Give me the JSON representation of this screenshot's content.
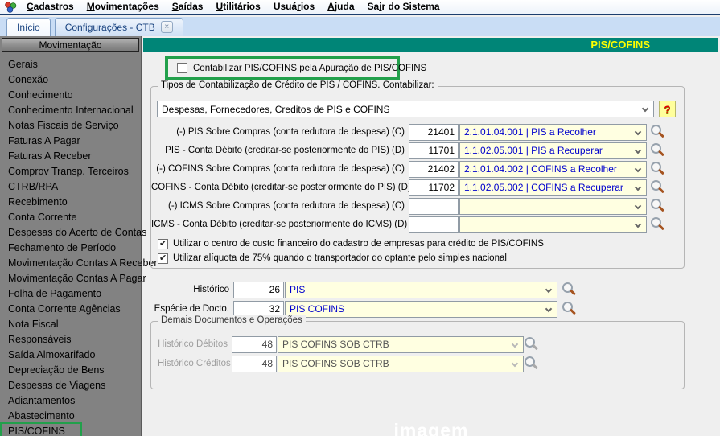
{
  "app": {
    "menu_items": [
      {
        "label": "Cadastros",
        "underline": 0
      },
      {
        "label": "Movimentações",
        "underline": 0
      },
      {
        "label": "Saídas",
        "underline": 0
      },
      {
        "label": "Utilitários",
        "underline": 0
      },
      {
        "label": "Usuários",
        "underline": 4
      },
      {
        "label": "Ajuda",
        "underline": 0
      },
      {
        "label": "Sair do Sistema",
        "underline": 2
      }
    ],
    "app_icon": "users-group-icon"
  },
  "tabs": [
    {
      "label": "Início",
      "closable": false
    },
    {
      "label": "Configurações - CTB",
      "closable": true,
      "close_icon": "close-icon"
    }
  ],
  "sidebar": {
    "header": "Movimentação",
    "items": [
      "Gerais",
      "Conexão",
      "Conhecimento",
      "Conhecimento Internacional",
      "Notas Fiscais de Serviço",
      "Faturas A Pagar",
      "Faturas A Receber",
      "Comprov Transp. Terceiros",
      "CTRB/RPA",
      "Recebimento",
      "Conta Corrente",
      "Despesas do Acerto de Contas",
      "Fechamento de Período",
      "Movimentação Contas A Receber",
      "Movimentação Contas A Pagar",
      "Folha de Pagamento",
      "Conta Corrente Agências",
      "Nota Fiscal",
      "Responsáveis",
      "Saída Almoxarifado",
      "Depreciação de Bens",
      "Despesas de Viagens",
      "Adiantamentos",
      "Abastecimento",
      "PIS/COFINS"
    ],
    "active_index": 24
  },
  "main": {
    "title": "PIS/COFINS",
    "apuracao_checkbox": {
      "label": "Contabilizar PIS/COFINS pela Apuração de PIS/COFINS",
      "checked": false
    },
    "credit_group": {
      "legend": "Tipos de Contabilização de Crédito de PIS / COFINS. Contabilizar:",
      "type_select_value": "Despesas, Fornecedores, Creditos de PIS e COFINS",
      "help_button": "?",
      "rows": [
        {
          "label": "(-) PIS Sobre Compras (conta redutora de despesa) (C)",
          "code": "21401",
          "account": "2.1.01.04.001 | PIS a Recolher"
        },
        {
          "label": "PIS - Conta Débito (creditar-se posteriormente do PIS) (D)",
          "code": "11701",
          "account": "1.1.02.05.001 | PIS a Recuperar"
        },
        {
          "label": "(-) COFINS Sobre Compras (conta redutora de despesa) (C)",
          "code": "21402",
          "account": "2.1.01.04.002 | COFINS a Recolher"
        },
        {
          "label": "COFINS - Conta Débito (creditar-se posteriormente do PIS) (D)",
          "code": "11702",
          "account": "1.1.02.05.002 | COFINS a Recuperar"
        },
        {
          "label": "(-) ICMS Sobre Compras (conta redutora de despesa) (C)",
          "code": "",
          "account": ""
        },
        {
          "label": "ICMS - Conta Débito (creditar-se posteriormente do ICMS) (D)",
          "code": "",
          "account": ""
        }
      ],
      "options": [
        {
          "label": "Utilizar o centro de custo financeiro do cadastro de empresas para crédito de PIS/COFINS",
          "checked": true
        },
        {
          "label": "Utilizar alíquota de 75% quando o transportador do optante pelo simples nacional",
          "checked": true
        }
      ]
    },
    "historico": {
      "label": "Histórico",
      "code": "26",
      "value": "PIS"
    },
    "especie": {
      "label": "Espécie de Docto.",
      "code": "32",
      "value": "PIS COFINS"
    },
    "demais_group": {
      "legend": "Demais Documentos e Operações",
      "rows": [
        {
          "label": "Histórico Débitos",
          "code": "48",
          "value": "PIS COFINS SOB CTRB",
          "enabled": false
        },
        {
          "label": "Histórico Créditos",
          "code": "48",
          "value": "PIS COFINS SOB CTRB",
          "enabled": false
        }
      ]
    },
    "watermark": "imagem"
  },
  "colors": {
    "titlebar_teal": "#008577",
    "title_text_yellow": "#ffff00",
    "highlight_green": "#22a04b",
    "field_yellow": "#ffffe1",
    "account_text_blue": "#0000cd",
    "sidebar_gray": "#828282",
    "tabstrip_blue": "#c9ddf5"
  }
}
